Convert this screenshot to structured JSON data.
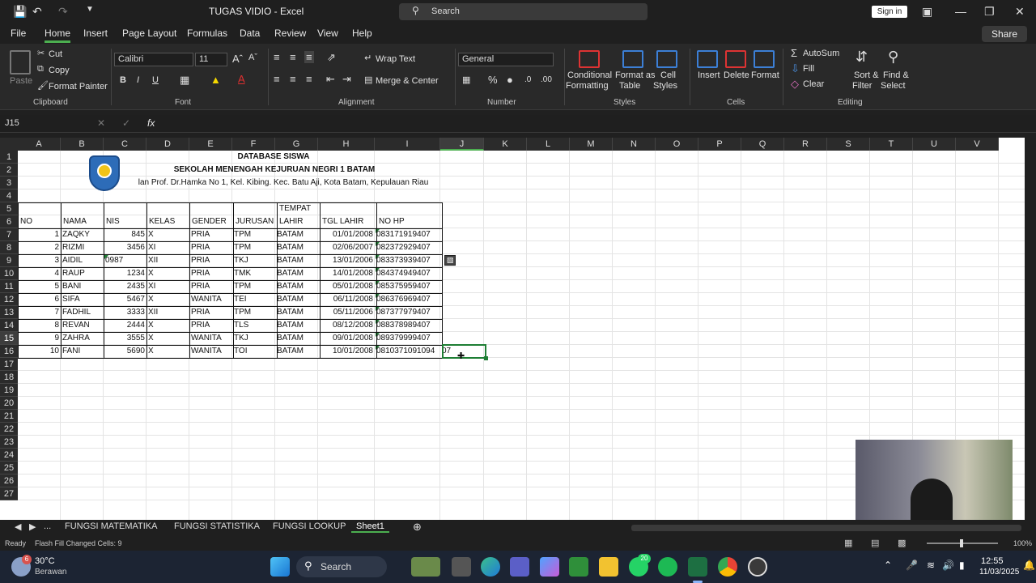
{
  "window": {
    "title": "TUGAS VIDIO  -  Excel",
    "search": "Search",
    "signin": "Sign in"
  },
  "menu": {
    "items": [
      "File",
      "Home",
      "Insert",
      "Page Layout",
      "Formulas",
      "Data",
      "Review",
      "View",
      "Help"
    ],
    "share": "Share"
  },
  "ribbon": {
    "clipboard": {
      "group": "Clipboard",
      "cut": "Cut",
      "copy": "Copy",
      "format_painter": "Format Painter",
      "paste": "Paste"
    },
    "font": {
      "group": "Font",
      "name": "Calibri",
      "size": "11",
      "bold": "B",
      "italic": "I",
      "underline": "U"
    },
    "alignment": {
      "group": "Alignment",
      "wrap": "Wrap Text",
      "merge": "Merge & Center"
    },
    "number": {
      "group": "Number",
      "format": "General"
    },
    "styles": {
      "group": "Styles",
      "conditional": "Conditional",
      "conditional2": "Formatting",
      "format_table": "Format as",
      "format_table2": "Table",
      "cell_styles": "Cell",
      "cell_styles2": "Styles"
    },
    "cells": {
      "group": "Cells",
      "insert": "Insert",
      "delete": "Delete",
      "format": "Format"
    },
    "editing": {
      "group": "Editing",
      "autosum": "AutoSum",
      "fill": "Fill",
      "clear": "Clear",
      "sort": "Sort &",
      "sort2": "Filter",
      "find": "Find &",
      "find2": "Select"
    }
  },
  "formula_bar": {
    "namebox": "J15",
    "fx": "fx",
    "value": ""
  },
  "columns": [
    "A",
    "B",
    "C",
    "D",
    "E",
    "F",
    "G",
    "H",
    "I",
    "J",
    "K",
    "L",
    "M",
    "N",
    "O",
    "P",
    "Q",
    "R",
    "S",
    "T",
    "U",
    "V"
  ],
  "rows": [
    "1",
    "2",
    "3",
    "4",
    "5",
    "6",
    "7",
    "8",
    "9",
    "10",
    "11",
    "12",
    "13",
    "14",
    "15",
    "16",
    "17",
    "18",
    "19",
    "20",
    "21",
    "22",
    "23",
    "24",
    "25",
    "26",
    "27"
  ],
  "sheet": {
    "title1": "DATABASE SISWA",
    "title2": "SEKOLAH MENENGAH KEJURUAN NEGRI 1 BATAM",
    "address": "lan Prof. Dr.Hamka No 1, Kel. Kibing. Kec. Batu Aji, Kota Batam, Kepulauan Riau",
    "headers": {
      "no": "NO",
      "nama": "NAMA",
      "nis": "NIS",
      "kelas": "KELAS",
      "gender": "GENDER",
      "jurusan": "JURUSAN",
      "tempat1": "TEMPAT",
      "tempat2": "LAHIR",
      "tgl": "TGL LAHIR",
      "hp": "NO HP"
    },
    "data": [
      {
        "no": "1",
        "nama": "ZAQKY",
        "nis": "845",
        "kelas": "X",
        "gender": "PRIA",
        "jurusan": "TPM",
        "tempat": "BATAM",
        "tgl": "01/01/2008",
        "hp": "083171919407"
      },
      {
        "no": "2",
        "nama": "RIZMI",
        "nis": "3456",
        "kelas": "XI",
        "gender": "PRIA",
        "jurusan": "TPM",
        "tempat": "BATAM",
        "tgl": "02/06/2007",
        "hp": "082372929407"
      },
      {
        "no": "3",
        "nama": "AIDIL",
        "nis": "0987",
        "kelas": "XII",
        "gender": "PRIA",
        "jurusan": "TKJ",
        "tempat": "BATAM",
        "tgl": "13/01/2006",
        "hp": "083373939407"
      },
      {
        "no": "4",
        "nama": "RAUP",
        "nis": "1234",
        "kelas": "X",
        "gender": "PRIA",
        "jurusan": "TMK",
        "tempat": "BATAM",
        "tgl": "14/01/2008",
        "hp": "084374949407"
      },
      {
        "no": "5",
        "nama": "BANI",
        "nis": "2435",
        "kelas": "XI",
        "gender": "PRIA",
        "jurusan": "TPM",
        "tempat": "BATAM",
        "tgl": "05/01/2008",
        "hp": "085375959407"
      },
      {
        "no": "6",
        "nama": "SIFA",
        "nis": "5467",
        "kelas": "X",
        "gender": "WANITA",
        "jurusan": "TEI",
        "tempat": "BATAM",
        "tgl": "06/11/2008",
        "hp": "086376969407"
      },
      {
        "no": "7",
        "nama": "FADHIL",
        "nis": "3333",
        "kelas": "XII",
        "gender": "PRIA",
        "jurusan": "TPM",
        "tempat": "BATAM",
        "tgl": "05/11/2006",
        "hp": "087377979407"
      },
      {
        "no": "8",
        "nama": "REVAN",
        "nis": "2444",
        "kelas": "X",
        "gender": "PRIA",
        "jurusan": "TLS",
        "tempat": "BATAM",
        "tgl": "08/12/2008",
        "hp": "088378989407"
      },
      {
        "no": "9",
        "nama": "ZAHRA",
        "nis": "3555",
        "kelas": "X",
        "gender": "WANITA",
        "jurusan": "TKJ",
        "tempat": "BATAM",
        "tgl": "09/01/2008",
        "hp": "089379999407"
      },
      {
        "no": "10",
        "nama": "FANI",
        "nis": "5690",
        "kelas": "X",
        "gender": "WANITA",
        "jurusan": "TOI",
        "tempat": "BATAM",
        "tgl": "10/01/2008",
        "hp": "0810371091094",
        "hp_overflow": "07"
      }
    ]
  },
  "tabs": {
    "more": "...",
    "items": [
      "FUNGSI MATEMATIKA",
      "FUNGSI STATISTIKA",
      "FUNGSI LOOKUP",
      "Sheet1"
    ]
  },
  "status": {
    "ready": "Ready",
    "message": "Flash Fill Changed Cells: 9",
    "zoom": "100%"
  },
  "taskbar": {
    "temp": "30°C",
    "weather": "Berawan",
    "badge": "6",
    "search": "Search",
    "time": "12:55",
    "date": "11/03/2025",
    "whatsapp_badge": "20"
  }
}
